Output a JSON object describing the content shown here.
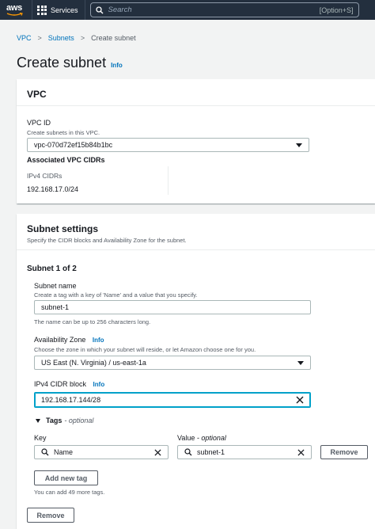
{
  "nav": {
    "logo": "aws",
    "services": "Services",
    "search_placeholder": "Search",
    "search_shortcut": "[Option+S]"
  },
  "breadcrumb": {
    "items": [
      "VPC",
      "Subnets",
      "Create subnet"
    ]
  },
  "page": {
    "title": "Create subnet",
    "info": "Info"
  },
  "vpc_panel": {
    "title": "VPC",
    "vpc_id_label": "VPC ID",
    "vpc_id_desc": "Create subnets in this VPC.",
    "vpc_id_value": "vpc-070d72ef15b84b1bc",
    "assoc_title": "Associated VPC CIDRs",
    "ipv4_label": "IPv4 CIDRs",
    "ipv4_value": "192.168.17.0/24"
  },
  "subnet_panel": {
    "title": "Subnet settings",
    "desc": "Specify the CIDR blocks and Availability Zone for the subnet.",
    "subnet_heading": "Subnet 1 of 2",
    "name_label": "Subnet name",
    "name_desc": "Create a tag with a key of 'Name' and a value that you specify.",
    "name_value": "subnet-1",
    "name_hint": "The name can be up to 256 characters long.",
    "az_label": "Availability Zone",
    "az_info": "Info",
    "az_desc": "Choose the zone in which your subnet will reside, or let Amazon choose one for you.",
    "az_value": "US East (N. Virginia) / us-east-1a",
    "cidr_label": "IPv4 CIDR block",
    "cidr_info": "Info",
    "cidr_value": "192.168.17.144/28",
    "tags_label": "Tags",
    "tags_optional": "optional",
    "key_label": "Key",
    "value_label": "Value",
    "value_optional": "optional",
    "tag_key": "Name",
    "tag_value": "subnet-1",
    "remove_tag": "Remove",
    "add_tag": "Add new tag",
    "tags_hint": "You can add 49 more tags.",
    "remove_subnet": "Remove"
  },
  "colors": {
    "nav_bg": "#232f3e",
    "link": "#0073bb",
    "focus": "#00a1c9"
  }
}
